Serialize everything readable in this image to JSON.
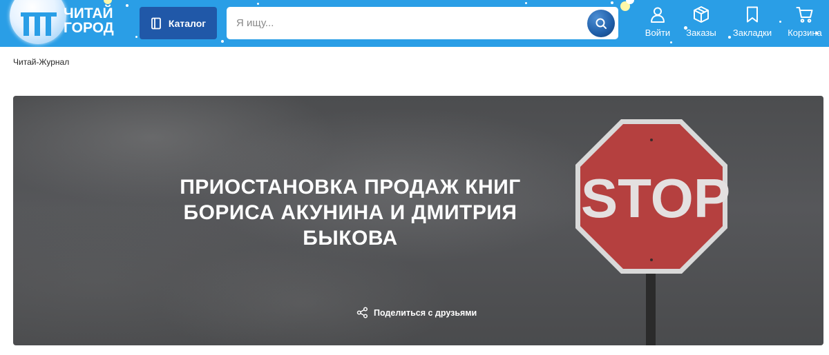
{
  "header": {
    "logo": {
      "line1": "ЧИТАЙ",
      "line2": "ГОРОД"
    },
    "catalog_label": "Каталог",
    "search": {
      "placeholder": "Я ищу...",
      "value": ""
    },
    "nav": [
      {
        "label": "Войти",
        "icon": "user-icon"
      },
      {
        "label": "Заказы",
        "icon": "box-icon"
      },
      {
        "label": "Закладки",
        "icon": "bookmark-icon"
      },
      {
        "label": "Корзина",
        "icon": "cart-icon"
      }
    ],
    "colors": {
      "header_bg": "#2a9ee6",
      "catalog_bg": "#2058a8"
    }
  },
  "breadcrumb": {
    "label": "Читай-Журнал"
  },
  "hero": {
    "title_lines": [
      "ПРИОСТАНОВКА ПРОДАЖ КНИГ",
      "БОРИСА АКУНИНА И ДМИТРИЯ",
      "БЫКОВА"
    ],
    "sign_text": "STOP",
    "share_label": "Поделиться с друзьями",
    "sign_color": "#b5403f"
  }
}
